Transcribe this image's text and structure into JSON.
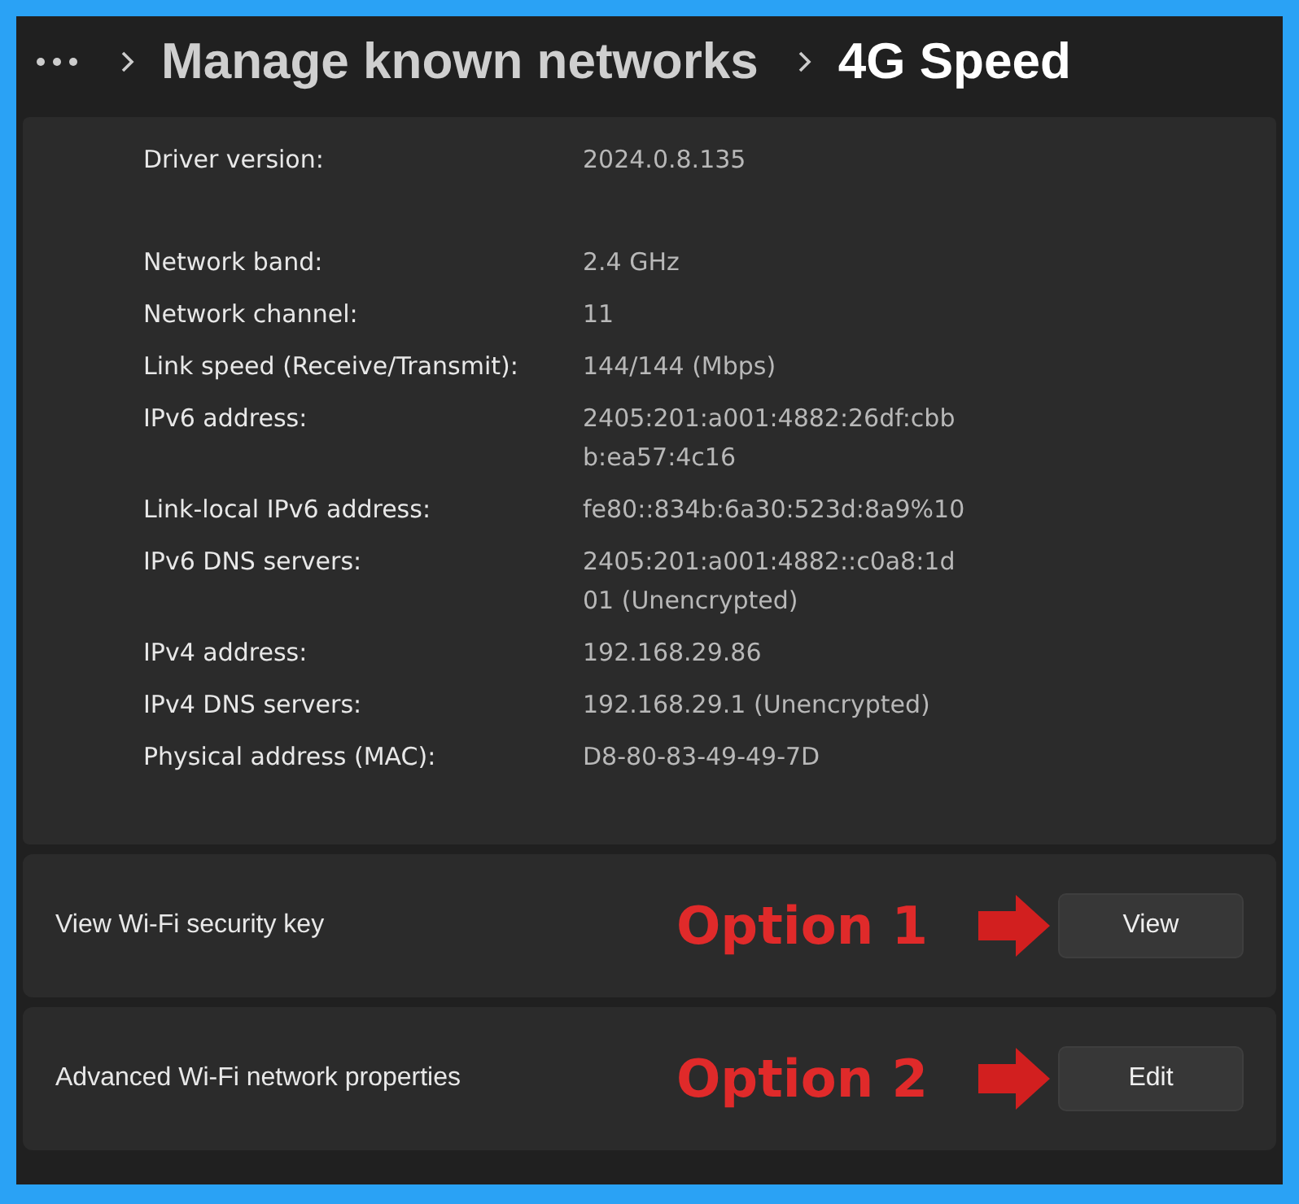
{
  "breadcrumb": {
    "items": [
      "Manage known networks",
      "4G Speed"
    ]
  },
  "details": [
    {
      "label": "Driver version:",
      "value": "2024.0.8.135"
    },
    {
      "label": "Network band:",
      "value": "2.4 GHz"
    },
    {
      "label": "Network channel:",
      "value": "11"
    },
    {
      "label": "Link speed (Receive/Transmit):",
      "value": "144/144 (Mbps)"
    },
    {
      "label": "IPv6 address:",
      "value": "2405:201:a001:4882:26df:cbbb:ea57:4c16"
    },
    {
      "label": "Link-local IPv6 address:",
      "value": "fe80::834b:6a30:523d:8a9%10"
    },
    {
      "label": "IPv6 DNS servers:",
      "value": "2405:201:a001:4882::c0a8:1d01 (Unencrypted)"
    },
    {
      "label": "IPv4 address:",
      "value": "192.168.29.86"
    },
    {
      "label": "IPv4 DNS servers:",
      "value": "192.168.29.1 (Unencrypted)"
    },
    {
      "label": "Physical address (MAC):",
      "value": "D8-80-83-49-49-7D"
    }
  ],
  "settings": [
    {
      "label": "View Wi-Fi security key",
      "annotation": "Option 1",
      "button": "View"
    },
    {
      "label": "Advanced Wi-Fi network properties",
      "annotation": "Option 2",
      "button": "Edit"
    }
  ]
}
